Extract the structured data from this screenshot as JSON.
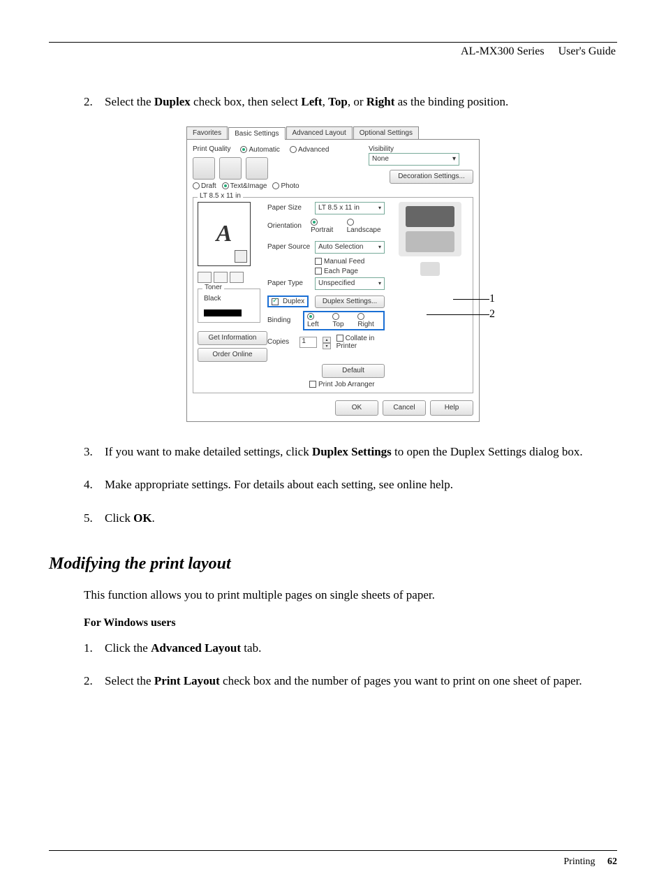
{
  "header": {
    "product": "AL-MX300 Series",
    "doc": "User's Guide"
  },
  "step2": {
    "num": "2.",
    "prefix": "Select the ",
    "b1": "Duplex",
    "mid1": " check box, then select ",
    "b2": "Left",
    "mid2": ", ",
    "b3": "Top",
    "mid3": ", or ",
    "b4": "Right",
    "suffix": " as the binding position."
  },
  "dialog": {
    "tabs": {
      "favorites": "Favorites",
      "basic": "Basic Settings",
      "advanced": "Advanced Layout",
      "optional": "Optional Settings"
    },
    "pq": {
      "label": "Print Quality",
      "automatic": "Automatic",
      "advanced": "Advanced",
      "draft": "Draft",
      "textimage": "Text&Image",
      "photo": "Photo"
    },
    "visibility": {
      "label": "Visibility",
      "value": "None",
      "deco": "Decoration Settings..."
    },
    "paper": {
      "legend": "LT 8.5 x 11 in",
      "previewLetter": "A",
      "paperSize": {
        "label": "Paper Size",
        "value": "LT 8.5 x 11 in"
      },
      "orientation": {
        "label": "Orientation",
        "portrait": "Portrait",
        "landscape": "Landscape"
      },
      "paperSource": {
        "label": "Paper Source",
        "value": "Auto Selection",
        "manual": "Manual Feed",
        "each": "Each Page"
      },
      "paperType": {
        "label": "Paper Type",
        "value": "Unspecified"
      }
    },
    "toner": {
      "legend": "Toner",
      "black": "Black"
    },
    "duplex": {
      "check": "Duplex",
      "settings": "Duplex Settings..."
    },
    "binding": {
      "label": "Binding",
      "left": "Left",
      "top": "Top",
      "right": "Right"
    },
    "copies": {
      "label": "Copies",
      "value": "1",
      "collate": "Collate in Printer"
    },
    "sideButtons": {
      "getInfo": "Get Information",
      "order": "Order Online"
    },
    "defaultBtn": "Default",
    "pja": "Print Job Arranger",
    "footer": {
      "ok": "OK",
      "cancel": "Cancel",
      "help": "Help"
    }
  },
  "callouts": {
    "one": "1",
    "two": "2"
  },
  "step3": {
    "num": "3.",
    "prefix": "If you want to make detailed settings, click ",
    "bold": "Duplex Settings",
    "suffix": " to open the Duplex Settings dialog box."
  },
  "step4": {
    "num": "4.",
    "text": "Make appropriate settings. For details about each setting, see online help."
  },
  "step5": {
    "num": "5.",
    "prefix": "Click ",
    "bold": "OK",
    "suffix": "."
  },
  "section": {
    "heading": "Modifying the print layout",
    "intro": "This function allows you to print multiple pages on single sheets of paper.",
    "subheading": "For Windows users"
  },
  "win1": {
    "num": "1.",
    "prefix": "Click the ",
    "bold": "Advanced Layout",
    "suffix": " tab."
  },
  "win2": {
    "num": "2.",
    "prefix": "Select the ",
    "bold": "Print Layout",
    "suffix": " check box and the number of pages you want to print on one sheet of paper."
  },
  "footer": {
    "chapter": "Printing",
    "page": "62"
  }
}
